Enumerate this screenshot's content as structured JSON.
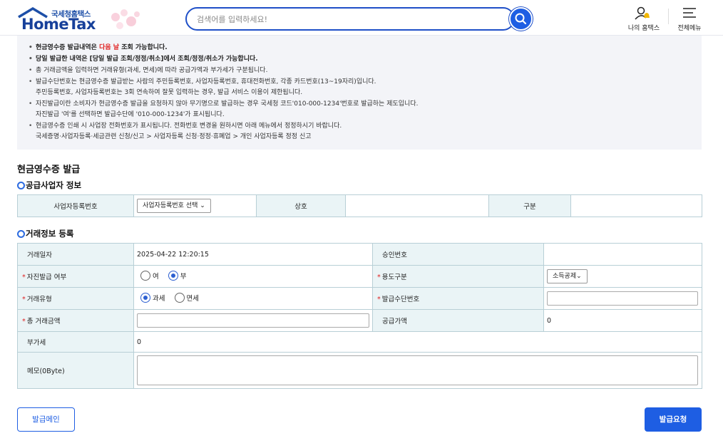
{
  "header": {
    "logo_kor": "국세청홈택스",
    "logo_eng": "HomeTax",
    "search_placeholder": "검색어를 입력하세요!",
    "my_hometax": "나의 홈택스",
    "all_menu": "전체메뉴"
  },
  "notices": [
    {
      "text": "현금영수증 발급내역은 ",
      "red": "다음 날",
      "tail": " 조회 가능합니다.",
      "bold": true
    },
    {
      "text": "당일 발급한 내역은 [당일 발급 조회/정정/취소]에서 조회/정정/취소가 가능합니다.",
      "bold": true
    },
    {
      "text": "총 거래금액을 입력하면 거래유형(과세, 면세)에 따라 공급가액과 부가세가 구분됩니다."
    },
    {
      "text": "발급수단번호는 현금영수증 발급받는 사람의  주민등록번호, 사업자등록번호, 휴대전화번호, 각종 카드번호(13~19자리)입니다.",
      "sub": "주민등록번호, 사업자등록번호는 3회 연속하여 잘못 입력하는 경우, 발급 서비스 이용이 제한됩니다."
    },
    {
      "text": "자진발급이란 소비자가 현금영수증 발급을 요청하지 않아 무기명으로 발급하는 경우 국세청 코드'010-000-1234'번호로 발급하는 제도입니다.",
      "sub": "자진발급 '여'를 선택하면 발급수단에 '010-000-1234'가 표시됩니다."
    },
    {
      "text": "현금영수증 인쇄 시 사업장 전화번호가 표시됩니다. 전화번호 변경을 원하시면 아래 메뉴에서 정정하시기 바랍니다.",
      "sub": "국세증명·사업자등록·세금관련 신청/신고 > 사업자등록 신청·정정·휴폐업 > 개인 사업자등록 정정 신고"
    }
  ],
  "section_title": "현금영수증 발급",
  "supplier": {
    "title": "공급사업자 정보",
    "biz_no_label": "사업자등록번호",
    "biz_no_select": "사업자등록번호 선택",
    "name_label": "상호",
    "type_label": "구분"
  },
  "trade": {
    "title": "거래정보 등록",
    "date_label": "거래일자",
    "date_value": "2025-04-22 12:20:15",
    "approval_label": "승인번호",
    "self_issue_label": "자진발급 여부",
    "self_yes": "여",
    "self_no": "부",
    "usage_label": "용도구분",
    "usage_value": "소득공제",
    "trade_type_label": "거래유형",
    "taxable": "과세",
    "exempt": "면세",
    "means_label": "발급수단번호",
    "total_label": "총 거래금액",
    "supply_label": "공급가액",
    "supply_value": "0",
    "vat_label": "부가세",
    "vat_value": "0",
    "memo_label": "메모(0Byte)"
  },
  "buttons": {
    "main": "발급메인",
    "request": "발급요청"
  },
  "colors": {
    "accent": "#1e5ee3",
    "table_header_bg": "#eaf4f6",
    "notice_bg": "#f3f4f8",
    "required": "#e02020"
  }
}
